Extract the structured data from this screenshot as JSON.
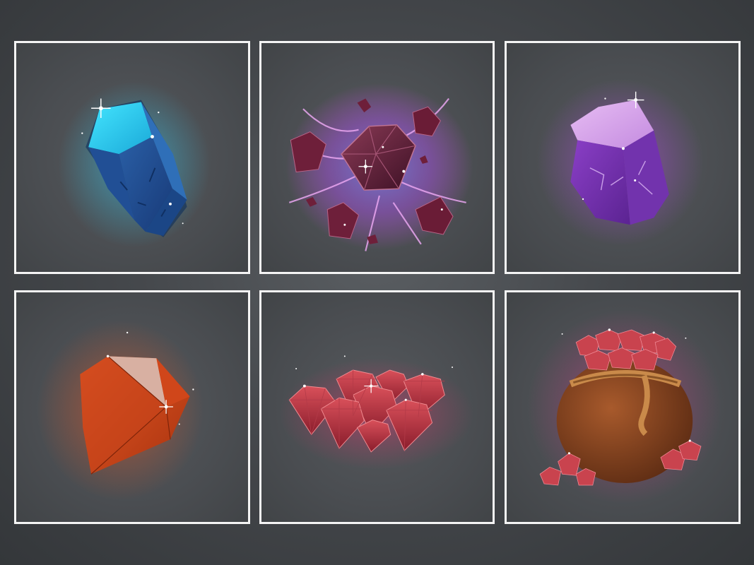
{
  "grid": {
    "tiles": [
      {
        "icon": "blue-crystal-icon",
        "accent": "#2ec9f2"
      },
      {
        "icon": "dark-gem-explosion-icon",
        "accent": "#c04bd6"
      },
      {
        "icon": "purple-crystal-icon",
        "accent": "#b546e8"
      },
      {
        "icon": "orange-crystal-icon",
        "accent": "#e2521f"
      },
      {
        "icon": "ruby-pile-icon",
        "accent": "#e0306b"
      },
      {
        "icon": "pot-of-rubies-icon",
        "accent": "#d9338a"
      }
    ]
  },
  "colors": {
    "background": "#45484c",
    "tile_border": "#f4f4f4",
    "tile_fill": "#4a4d51"
  }
}
